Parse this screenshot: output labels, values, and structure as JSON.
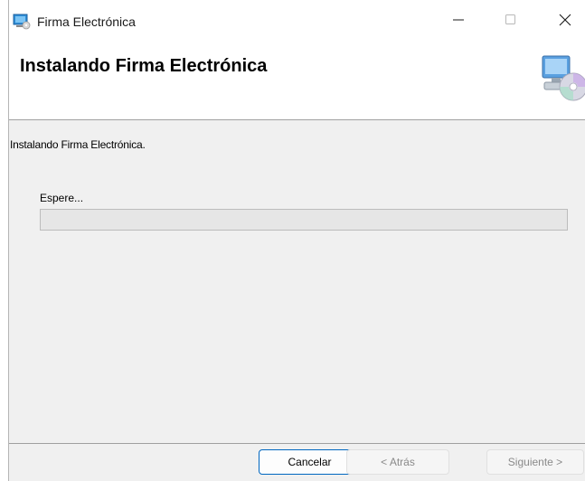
{
  "window": {
    "title": "Firma Electrónica",
    "app_icon": "installer-icon",
    "controls": {
      "minimize_icon": "minimize-icon",
      "maximize_icon": "maximize-icon",
      "close_icon": "close-icon"
    }
  },
  "header": {
    "title": "Instalando Firma Electrónica",
    "icon": "computer-cd-icon"
  },
  "body": {
    "status": "Instalando Firma Electrónica.",
    "wait_label": "Espere...",
    "progress_fraction": 0
  },
  "buttons": {
    "cancel": "Cancelar",
    "back": "< Atrás",
    "next": "Siguiente >"
  },
  "colors": {
    "accent": "#0067c0",
    "progress_fill": "#06b025"
  }
}
